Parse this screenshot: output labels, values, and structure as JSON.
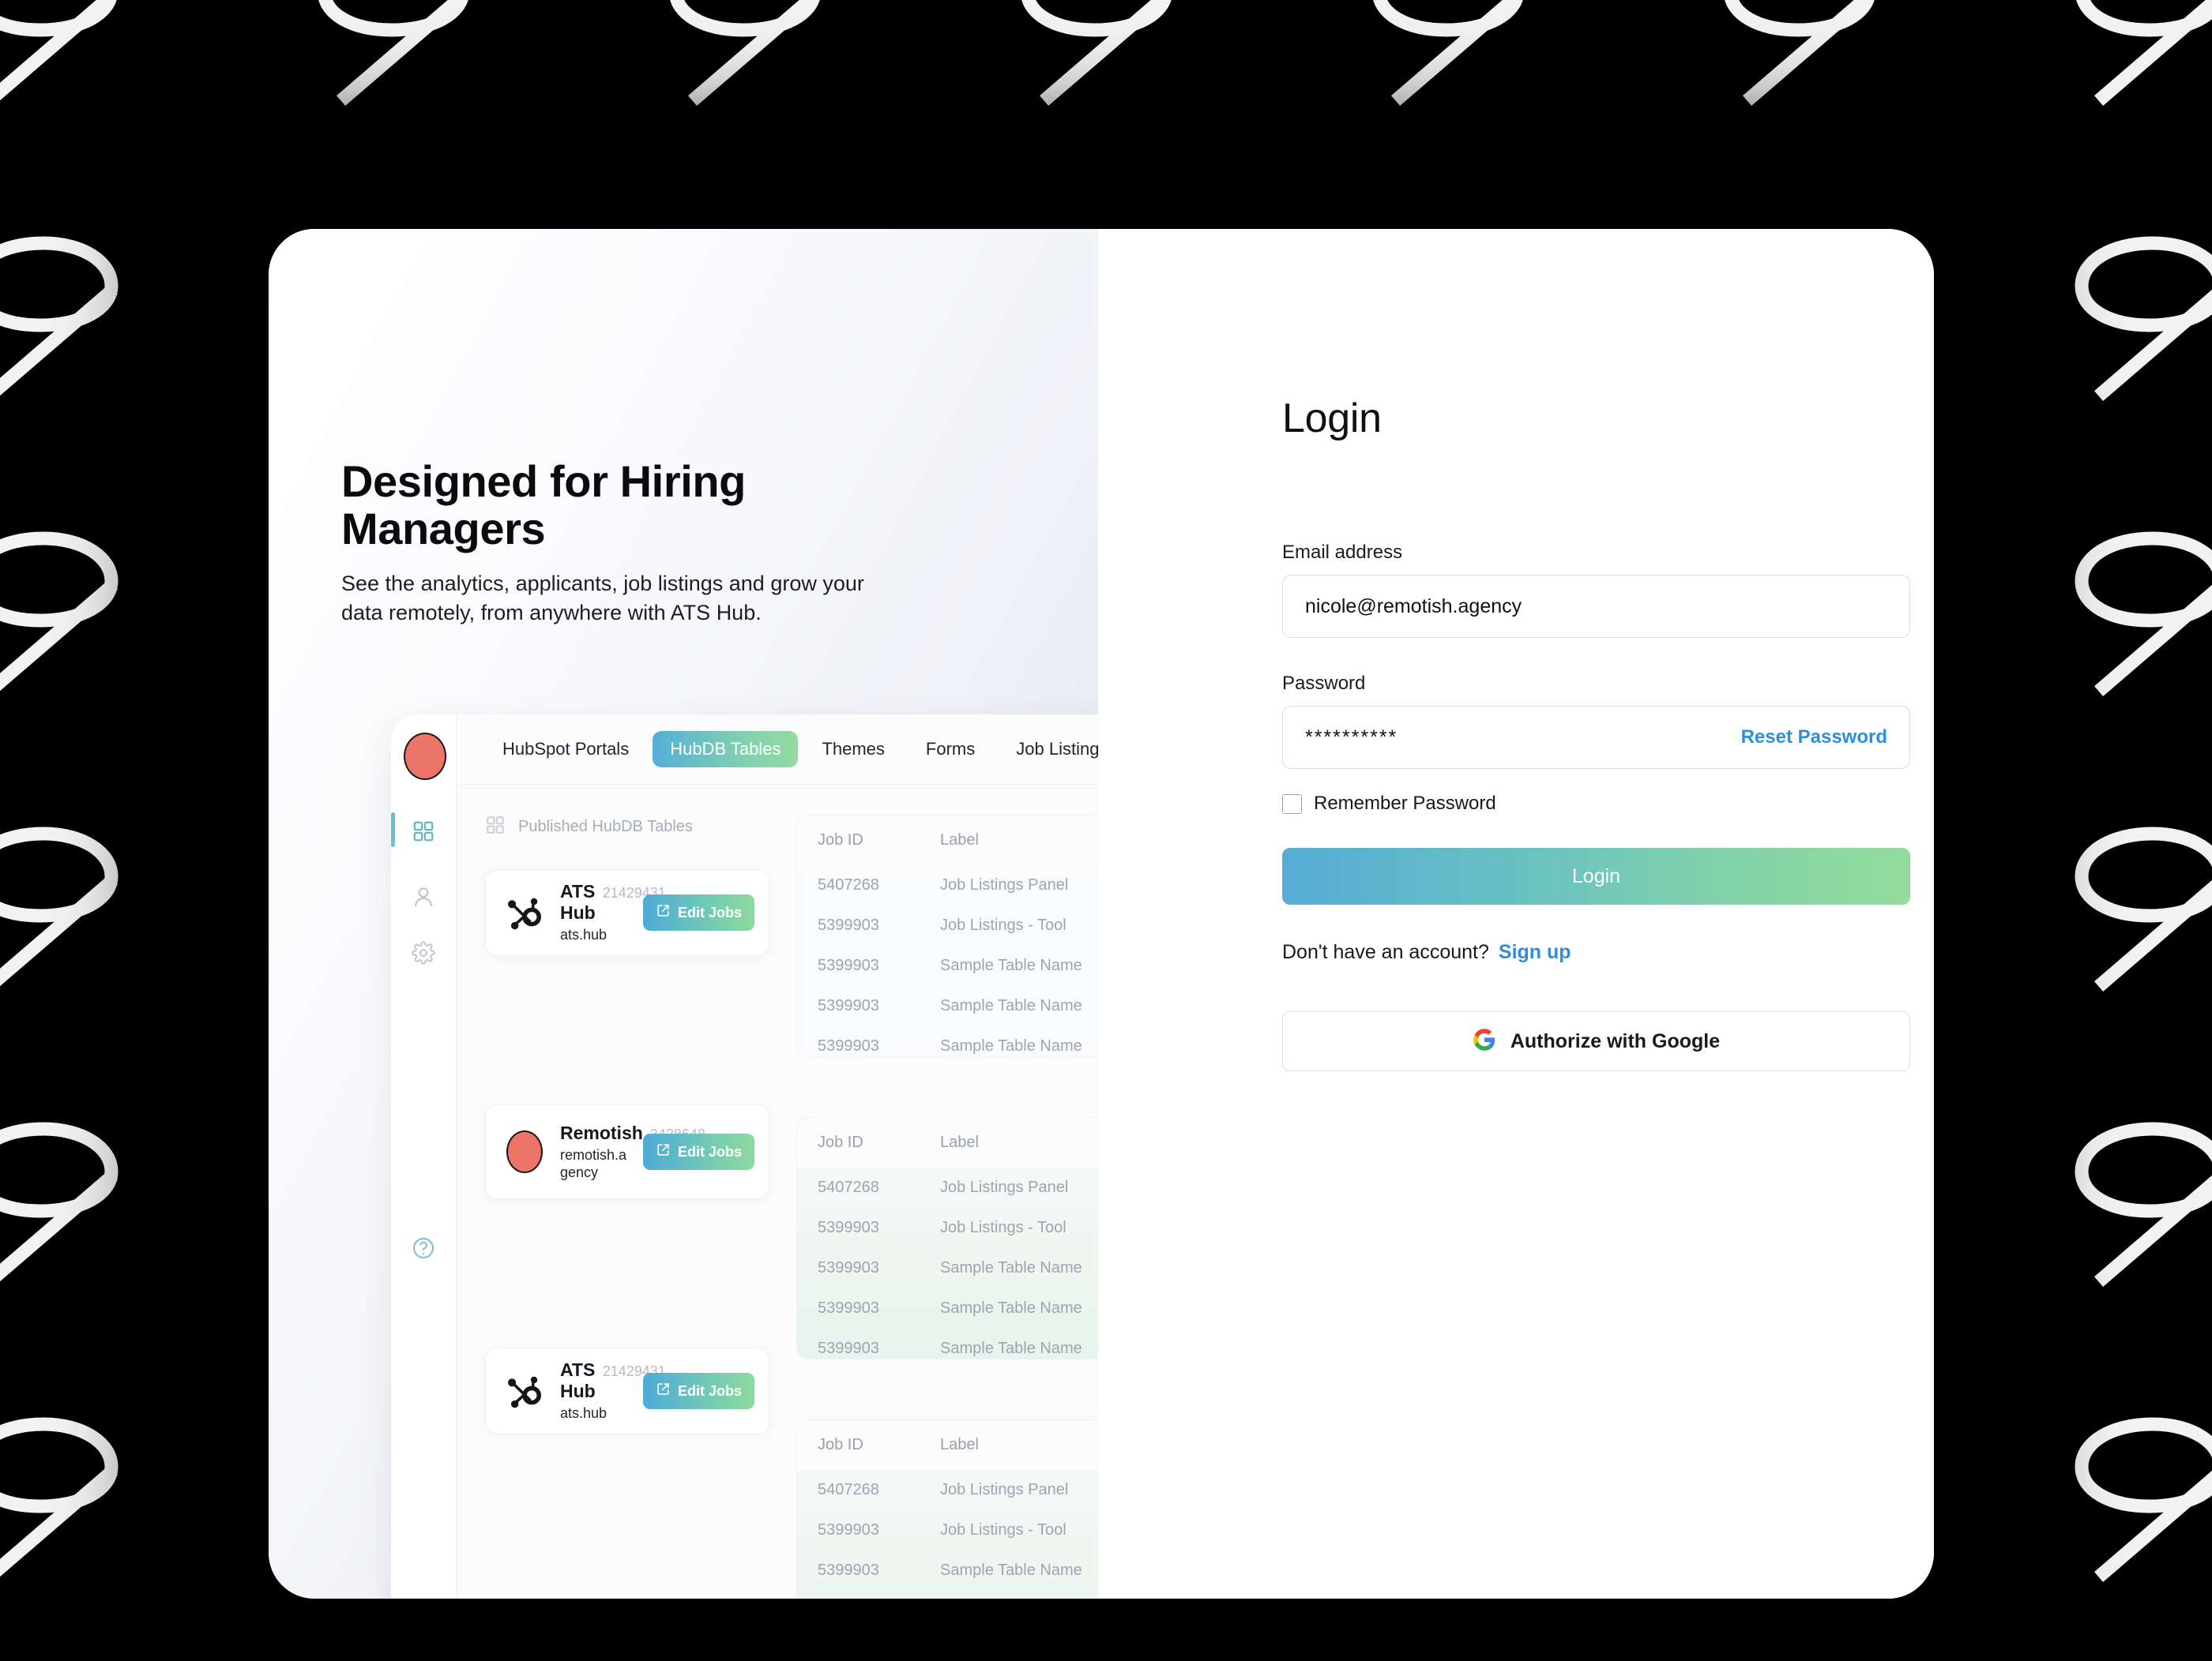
{
  "background": {
    "pattern_glyph": "9",
    "pattern_color": "#f2f2f2",
    "backdrop_color": "#000000"
  },
  "promo": {
    "title": "Designed for Hiring Managers",
    "subtitle": "See the analytics, applicants, job listings and grow your data remotely, from anywhere with ATS Hub."
  },
  "preview": {
    "sidebar": {
      "avatar_color": "#eb7566",
      "items": [
        {
          "icon": "grid-icon",
          "active": true
        },
        {
          "icon": "user-icon",
          "active": false
        },
        {
          "icon": "gear-icon",
          "active": false
        },
        {
          "icon": "help-icon",
          "active": false
        }
      ]
    },
    "tabs": [
      {
        "label": "HubSpot Portals",
        "selected": false
      },
      {
        "label": "HubDB Tables",
        "selected": true
      },
      {
        "label": "Themes",
        "selected": false
      },
      {
        "label": "Forms",
        "selected": false
      },
      {
        "label": "Job Listings",
        "selected": false
      }
    ],
    "section_label": "Published HubDB Tables",
    "edit_jobs_label": "Edit Jobs",
    "portals": [
      {
        "name": "ATS Hub",
        "id": "21429431",
        "domain": "ats.hub",
        "logo": "hubspot-sprocket-icon"
      },
      {
        "name": "Remotish",
        "id": "3428648",
        "domain": "remotish.agency",
        "logo": "remotish-avatar-icon"
      },
      {
        "name": "ATS Hub",
        "id": "21429431",
        "domain": "ats.hub",
        "logo": "hubspot-sprocket-icon"
      }
    ],
    "table": {
      "columns": [
        "Job ID",
        "Label"
      ],
      "rows": [
        {
          "job_id": "5407268",
          "label": "Job Listings Panel"
        },
        {
          "job_id": "5399903",
          "label": "Job Listings - Tool"
        },
        {
          "job_id": "5399903",
          "label": "Sample Table Name"
        },
        {
          "job_id": "5399903",
          "label": "Sample Table Name"
        },
        {
          "job_id": "5399903",
          "label": "Sample Table Name"
        }
      ]
    }
  },
  "login": {
    "heading": "Login",
    "email": {
      "label": "Email address",
      "value": "nicole@remotish.agency",
      "placeholder": "Email address"
    },
    "password": {
      "label": "Password",
      "value": "**********",
      "placeholder": "Password",
      "reset_label": "Reset Password"
    },
    "remember_label": "Remember Password",
    "remember_checked": false,
    "submit_label": "Login",
    "signup_prompt": "Don't have an account?",
    "signup_link": "Sign up",
    "google_label": "Authorize with Google",
    "accent_link_color": "#2e8fd8",
    "button_gradient_from": "#55acd6",
    "button_gradient_to": "#92dc9b"
  }
}
